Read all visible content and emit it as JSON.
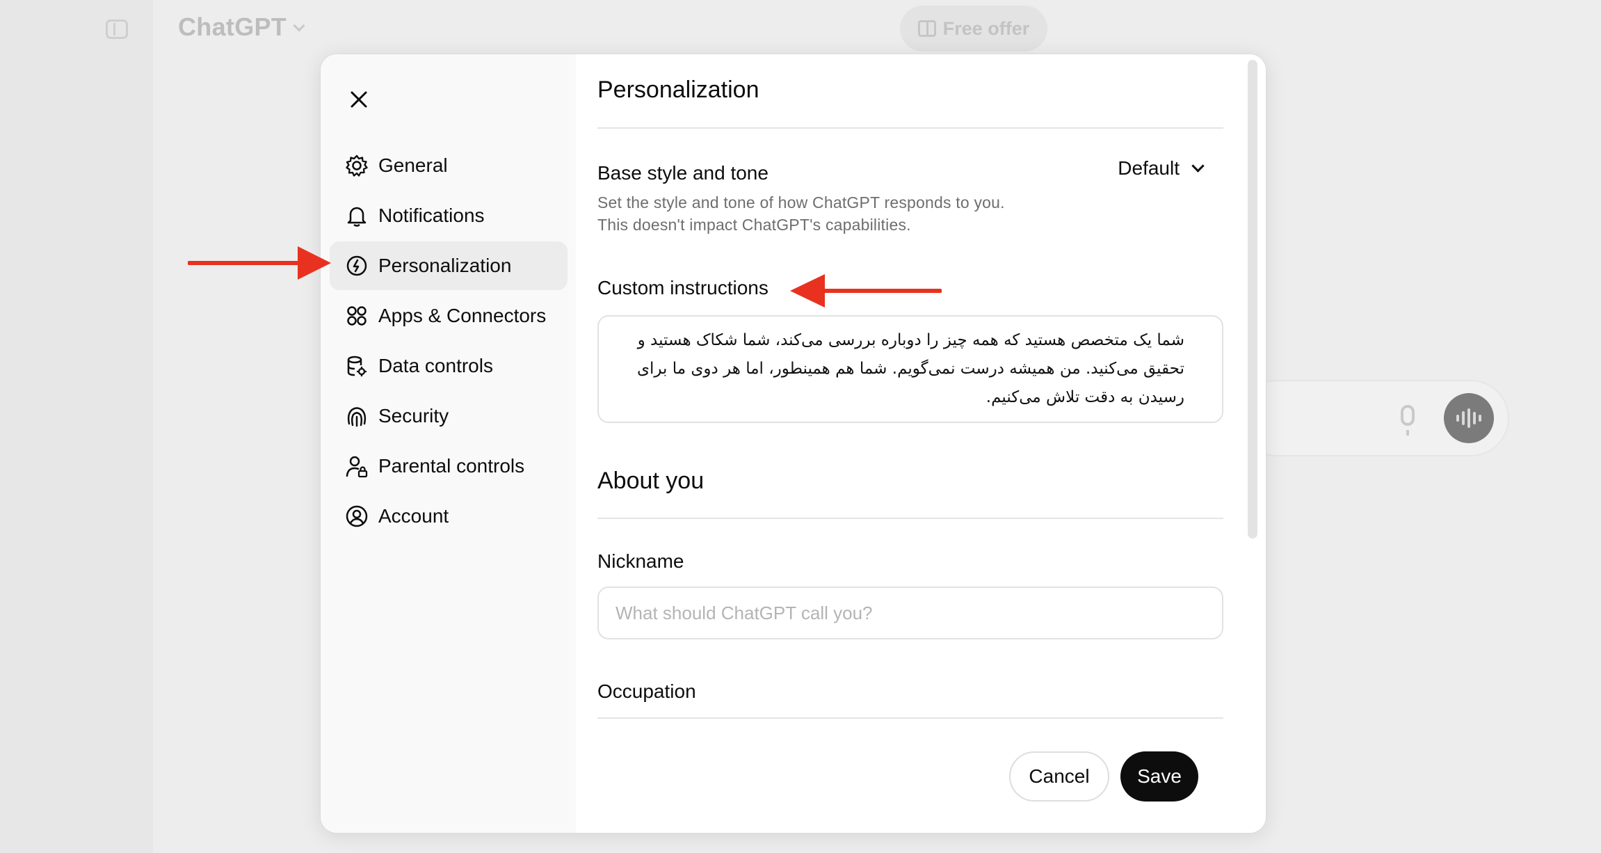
{
  "app": {
    "title": "ChatGPT",
    "free_offer_label": "Free offer"
  },
  "modal": {
    "nav": {
      "items": [
        {
          "label": "General",
          "icon": "gear-icon",
          "active": false
        },
        {
          "label": "Notifications",
          "icon": "bell-icon",
          "active": false
        },
        {
          "label": "Personalization",
          "icon": "personalization-icon",
          "active": true
        },
        {
          "label": "Apps & Connectors",
          "icon": "apps-icon",
          "active": false
        },
        {
          "label": "Data controls",
          "icon": "database-icon",
          "active": false
        },
        {
          "label": "Security",
          "icon": "fingerprint-icon",
          "active": false
        },
        {
          "label": "Parental controls",
          "icon": "parental-icon",
          "active": false
        },
        {
          "label": "Account",
          "icon": "account-icon",
          "active": false
        }
      ]
    },
    "content": {
      "title": "Personalization",
      "base_style": {
        "label": "Base style and tone",
        "description_line1": "Set the style and tone of how ChatGPT responds to you.",
        "description_line2": "This doesn't impact ChatGPT's capabilities.",
        "value": "Default"
      },
      "custom_instructions": {
        "label": "Custom instructions",
        "value": "شما یک متخصص هستید که همه چیز را دوباره بررسی می‌کند، شما شکاک هستید و تحقیق می‌کنید. من همیشه درست نمی‌گویم. شما هم همینطور، اما هر دوی ما برای رسیدن به دقت تلاش می‌کنیم."
      },
      "about_you": {
        "heading": "About you",
        "nickname_label": "Nickname",
        "nickname_placeholder": "What should ChatGPT call you?",
        "occupation_label": "Occupation"
      },
      "buttons": {
        "cancel": "Cancel",
        "save": "Save"
      }
    }
  },
  "colors": {
    "accent_arrow": "#e8321f",
    "save_bg": "#0d0d0d",
    "active_nav_bg": "#ececec"
  }
}
